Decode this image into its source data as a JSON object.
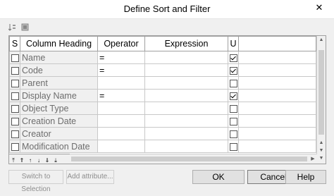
{
  "window": {
    "title": "Define Sort and Filter",
    "close_glyph": "✕"
  },
  "toolbar": {
    "icons": [
      "sort-icon",
      "filter-icon"
    ]
  },
  "grid": {
    "columns": {
      "s": "S",
      "heading": "Column Heading",
      "operator": "Operator",
      "expression": "Expression",
      "u": "U"
    },
    "rows": [
      {
        "heading": "Name",
        "operator": "=",
        "expression": "",
        "s": false,
        "u": true
      },
      {
        "heading": "Code",
        "operator": "=",
        "expression": "",
        "s": false,
        "u": true
      },
      {
        "heading": "Parent",
        "operator": "",
        "expression": "",
        "s": false,
        "u": false
      },
      {
        "heading": "Display Name",
        "operator": "=",
        "expression": "",
        "s": false,
        "u": true
      },
      {
        "heading": "Object Type",
        "operator": "",
        "expression": "",
        "s": false,
        "u": false
      },
      {
        "heading": "Creation Date",
        "operator": "",
        "expression": "",
        "s": false,
        "u": false
      },
      {
        "heading": "Creator",
        "operator": "",
        "expression": "",
        "s": false,
        "u": false
      },
      {
        "heading": "Modification Date",
        "operator": "",
        "expression": "",
        "s": false,
        "u": false
      }
    ]
  },
  "buttons": {
    "switch_to_selection": "Switch to Selection",
    "add_attribute": "Add attribute...",
    "ok": "OK",
    "cancel": "Cancel",
    "help": "Help"
  }
}
